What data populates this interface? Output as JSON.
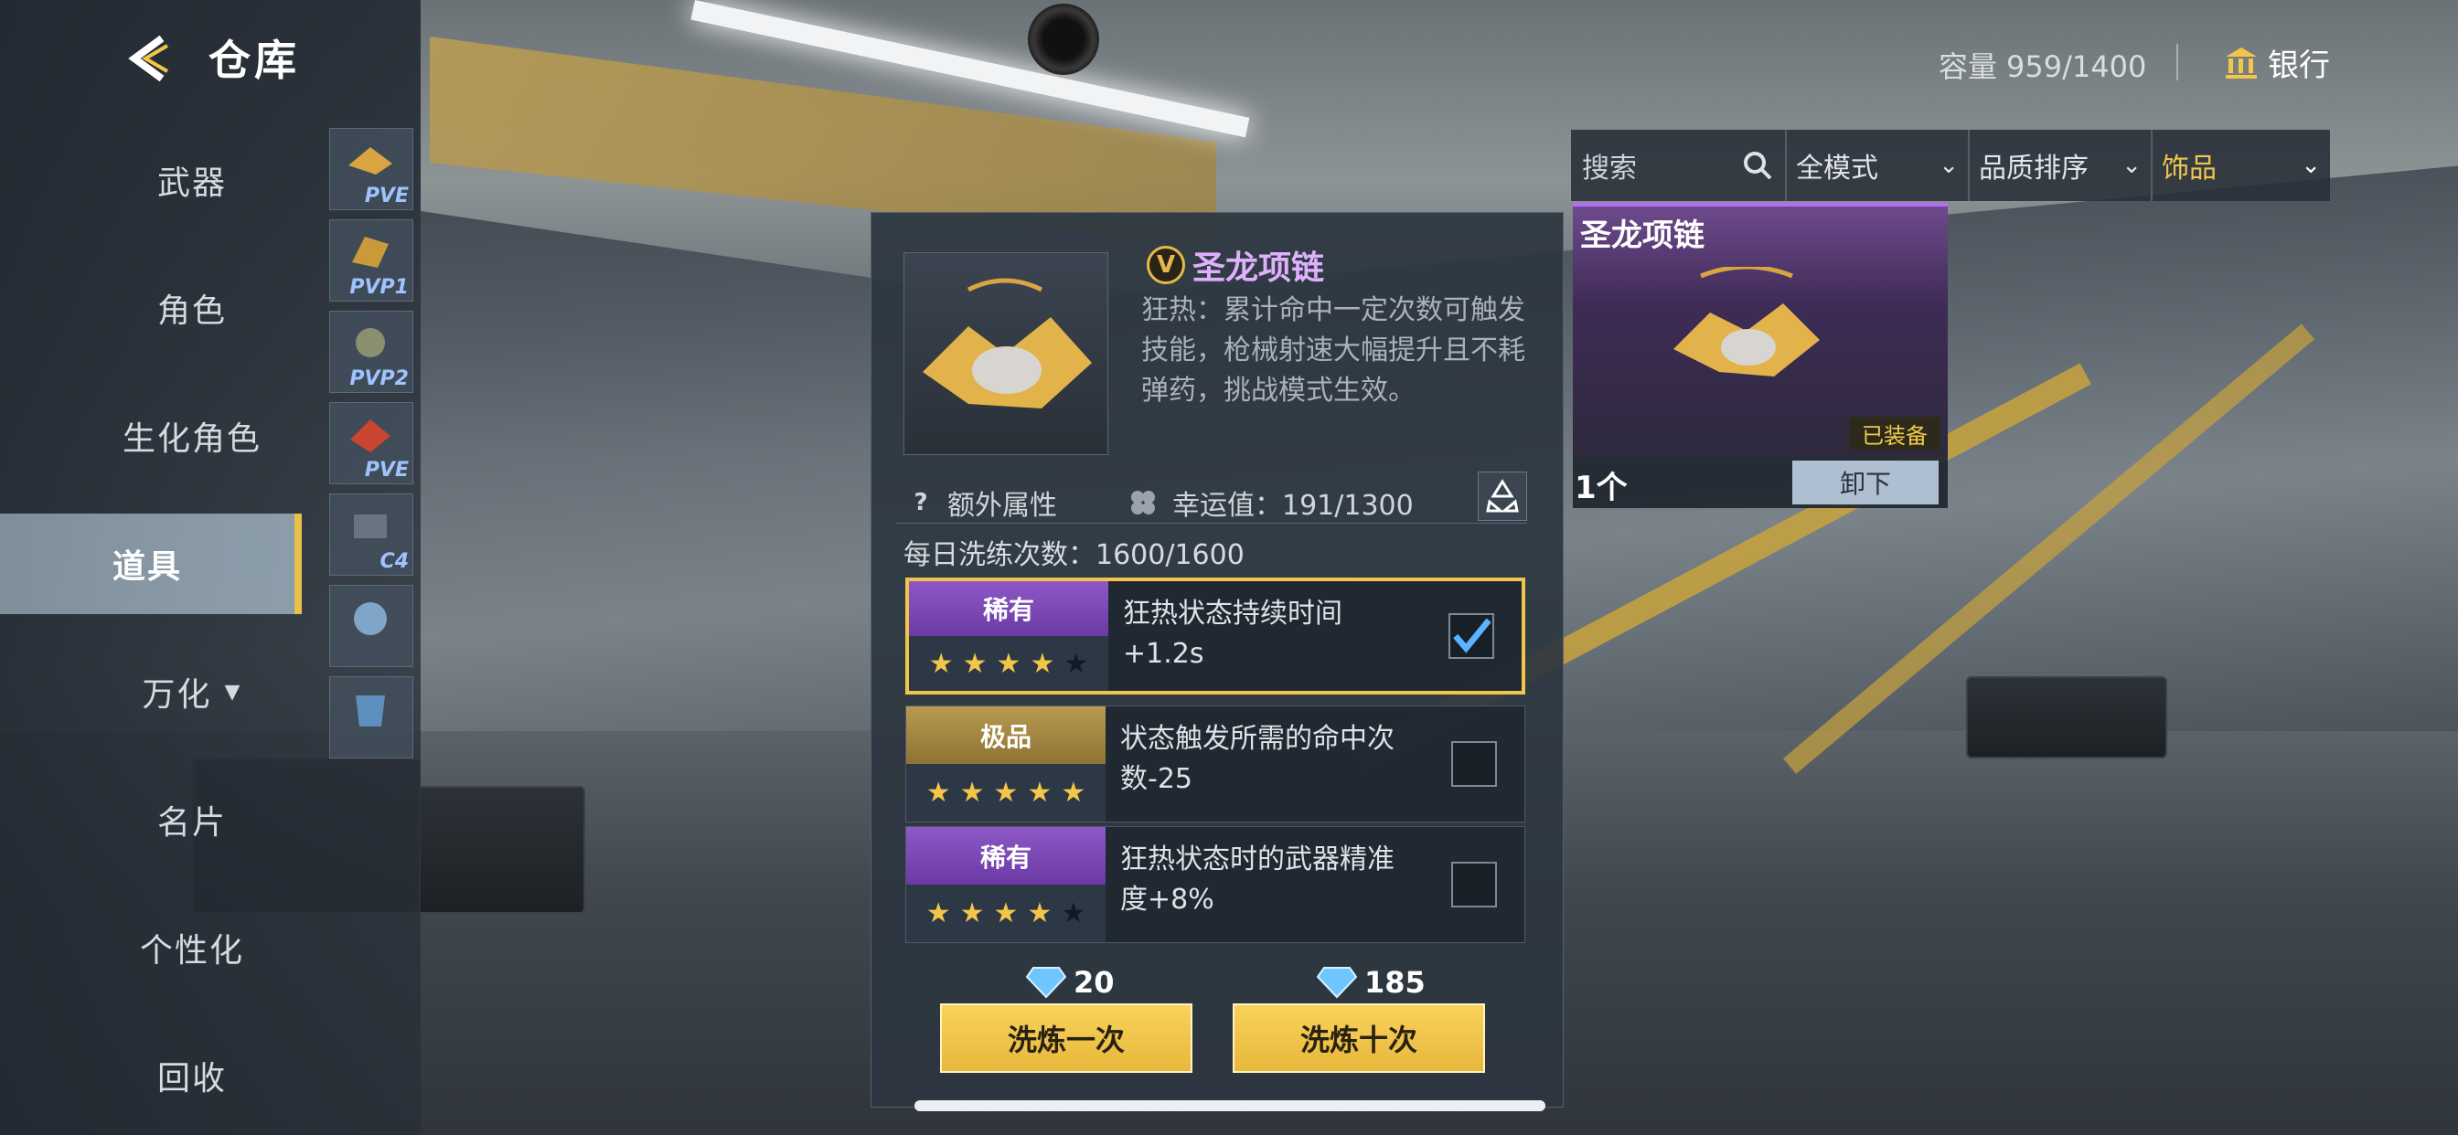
{
  "header": {
    "title": "仓库",
    "capacity_label": "容量",
    "capacity_value": "959/1400",
    "bank_label": "银行"
  },
  "nav": {
    "items": [
      {
        "label": "武器"
      },
      {
        "label": "角色"
      },
      {
        "label": "生化角色"
      },
      {
        "label": "道具"
      },
      {
        "label": "万化"
      },
      {
        "label": "名片"
      },
      {
        "label": "个性化"
      },
      {
        "label": "回收"
      }
    ],
    "active": "道具"
  },
  "subcategories": [
    {
      "tag": "PVE"
    },
    {
      "tag": "PVP1"
    },
    {
      "tag": "PVP2"
    },
    {
      "tag": "PVE"
    },
    {
      "tag": "C4"
    },
    {
      "tag": ""
    },
    {
      "tag": ""
    }
  ],
  "filters": {
    "search_placeholder": "搜索",
    "mode": "全模式",
    "sort": "品质排序",
    "category": "饰品"
  },
  "item_card": {
    "name": "圣龙项链",
    "equipped_label": "已装备",
    "count": "1个",
    "unload_label": "卸下"
  },
  "detail": {
    "name": "圣龙项链",
    "badge": "V",
    "description": "狂热：累计命中一定次数可触发技能，枪械射速大幅提升且不耗弹药，挑战模式生效。",
    "extra_label": "额外属性",
    "luck_label": "幸运值：191/1300",
    "daily_label": "每日洗练次数：1600/1600",
    "attributes": [
      {
        "rarity": "稀有",
        "text": "狂热状态持续时间+1.2s",
        "stars": 4,
        "checked": true
      },
      {
        "rarity": "极品",
        "text": "状态触发所需的命中次数-25",
        "stars": 5,
        "checked": false
      },
      {
        "rarity": "稀有",
        "text": "狂热状态时的武器精准度+8%",
        "stars": 4,
        "checked": false
      }
    ],
    "cost_once": "20",
    "cost_ten": "185",
    "btn_once": "洗炼一次",
    "btn_ten": "洗炼十次"
  },
  "colors": {
    "accent": "#f3c64a",
    "epic_purple": "#8d58c6",
    "legend_gold": "#b89a50"
  }
}
